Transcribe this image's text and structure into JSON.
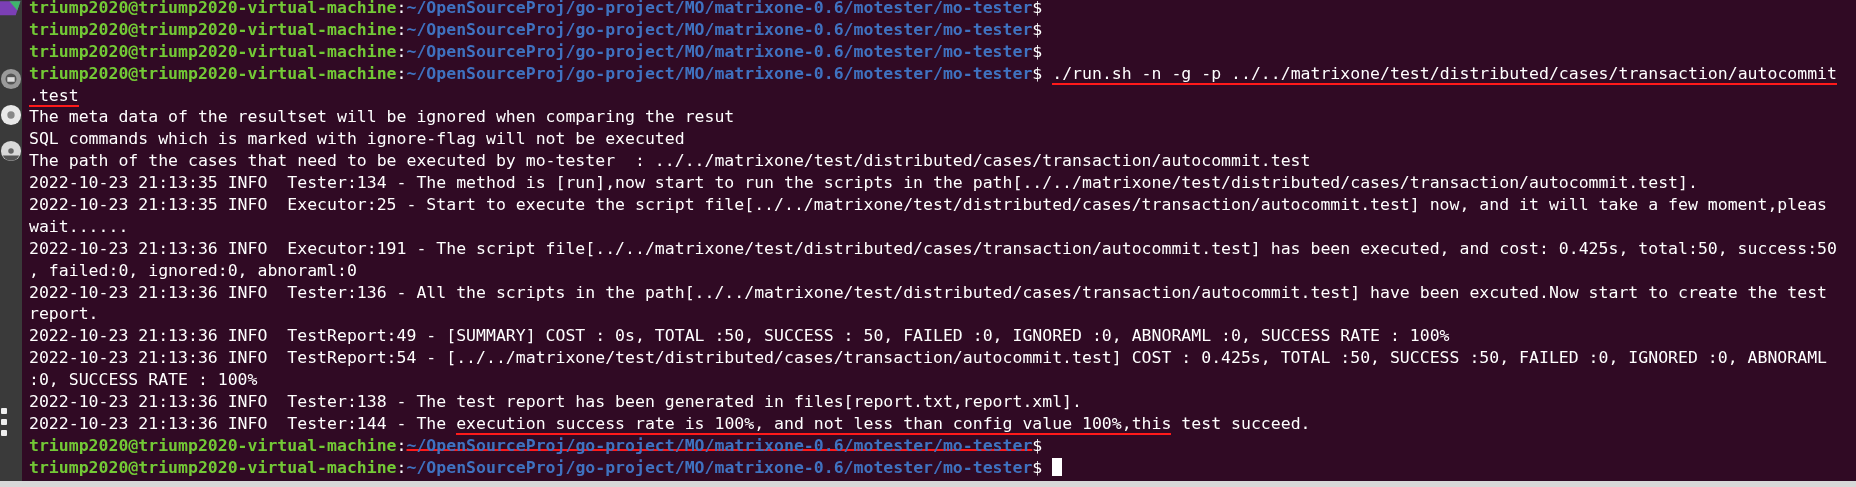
{
  "terminal": {
    "lines": [
      {
        "cursor": false,
        "segments": [
          {
            "text": "triump2020@triump2020-virtual-machine",
            "kind": "user"
          },
          {
            "text": ":",
            "kind": "text"
          },
          {
            "text": "~/OpenSourceProj/go-project/MO/matrixone-0.6/motester/mo-tester",
            "kind": "path"
          },
          {
            "text": "$",
            "kind": "text"
          }
        ]
      },
      {
        "cursor": false,
        "segments": [
          {
            "text": "triump2020@triump2020-virtual-machine",
            "kind": "user"
          },
          {
            "text": ":",
            "kind": "text"
          },
          {
            "text": "~/OpenSourceProj/go-project/MO/matrixone-0.6/motester/mo-tester",
            "kind": "path"
          },
          {
            "text": "$",
            "kind": "text"
          }
        ]
      },
      {
        "cursor": false,
        "segments": [
          {
            "text": "triump2020@triump2020-virtual-machine",
            "kind": "user"
          },
          {
            "text": ":",
            "kind": "text"
          },
          {
            "text": "~/OpenSourceProj/go-project/MO/matrixone-0.6/motester/mo-tester",
            "kind": "path"
          },
          {
            "text": "$",
            "kind": "text"
          }
        ]
      },
      {
        "cursor": false,
        "segments": [
          {
            "text": "triump2020@triump2020-virtual-machine",
            "kind": "user"
          },
          {
            "text": ":",
            "kind": "text"
          },
          {
            "text": "~/OpenSourceProj/go-project/MO/matrixone-0.6/motester/mo-tester",
            "kind": "path"
          },
          {
            "text": "$",
            "kind": "text"
          },
          {
            "text": "./run.sh -n -g -p ../../matrixone/test/distributed/cases/transaction/autocommit",
            "kind": "underlined"
          }
        ]
      },
      {
        "cursor": false,
        "segments": [
          {
            "text": ".test",
            "kind": "underlined"
          }
        ]
      },
      {
        "cursor": false,
        "segments": [
          {
            "text": "The meta data of the resultset will be ignored when comparing the resut",
            "kind": "text"
          }
        ]
      },
      {
        "cursor": false,
        "segments": [
          {
            "text": "SQL commands which is marked with ignore-flag will not be executed",
            "kind": "text"
          }
        ]
      },
      {
        "cursor": false,
        "segments": [
          {
            "text": "The path of the cases that need to be executed by mo-tester  : ../../matrixone/test/distributed/cases/transaction/autocommit.test",
            "kind": "text"
          }
        ]
      },
      {
        "cursor": false,
        "segments": [
          {
            "text": "2022-10-23 21:13:35 INFO  Tester:134 - The method is [run],now start to run the scripts in the path[../../matrixone/test/distributed/cases/transaction/autocommit.test].",
            "kind": "text"
          }
        ]
      },
      {
        "cursor": false,
        "segments": [
          {
            "text": "2022-10-23 21:13:35 INFO  Executor:25 - Start to execute the script file[../../matrixone/test/distributed/cases/transaction/autocommit.test] now, and it will take a few moment,pleas",
            "kind": "text"
          }
        ]
      },
      {
        "cursor": false,
        "segments": [
          {
            "text": "wait......",
            "kind": "text"
          }
        ]
      },
      {
        "cursor": false,
        "segments": [
          {
            "text": "2022-10-23 21:13:36 INFO  Executor:191 - The script file[../../matrixone/test/distributed/cases/transaction/autocommit.test] has been executed, and cost: 0.425s, total:50, success:50",
            "kind": "text"
          }
        ]
      },
      {
        "cursor": false,
        "segments": [
          {
            "text": ", failed:0, ignored:0, abnoraml:0",
            "kind": "text"
          }
        ]
      },
      {
        "cursor": false,
        "segments": [
          {
            "text": "2022-10-23 21:13:36 INFO  Tester:136 - All the scripts in the path[../../matrixone/test/distributed/cases/transaction/autocommit.test] have been excuted.Now start to create the test",
            "kind": "text"
          }
        ]
      },
      {
        "cursor": false,
        "segments": [
          {
            "text": "report.",
            "kind": "text"
          }
        ]
      },
      {
        "cursor": false,
        "segments": [
          {
            "text": "2022-10-23 21:13:36 INFO  TestReport:49 - [SUMMARY] COST : 0s, TOTAL :50, SUCCESS : 50, FAILED :0, IGNORED :0, ABNORAML :0, SUCCESS RATE : 100%",
            "kind": "text"
          }
        ]
      },
      {
        "cursor": false,
        "segments": [
          {
            "text": "2022-10-23 21:13:36 INFO  TestReport:54 - [../../matrixone/test/distributed/cases/transaction/autocommit.test] COST : 0.425s, TOTAL :50, SUCCESS :50, FAILED :0, IGNORED :0, ABNORAML",
            "kind": "text"
          }
        ]
      },
      {
        "cursor": false,
        "segments": [
          {
            "text": ":0, SUCCESS RATE : 100%",
            "kind": "text"
          }
        ]
      },
      {
        "cursor": false,
        "segments": [
          {
            "text": "2022-10-23 21:13:36 INFO  Tester:138 - The test report has been generated in files[report.txt,report.xml].",
            "kind": "text"
          }
        ]
      },
      {
        "cursor": false,
        "segments": [
          {
            "text": "2022-10-23 21:13:36 INFO  Tester:144 - The",
            "kind": "text"
          },
          {
            "text": "execution success rate is 100%, and not less than config value 100%,this",
            "kind": "underlined"
          },
          {
            "text": "test succeed.",
            "kind": "text"
          }
        ]
      },
      {
        "cursor": false,
        "segments": [
          {
            "text": "triump2020@triump2020-virtual-machine",
            "kind": "user"
          },
          {
            "text": ":",
            "kind": "text"
          },
          {
            "text": "~/OpenSourceProj/go-project/MO/matrixone-0.6/motester/mo-tester",
            "kind": "struck-path"
          },
          {
            "text": "$",
            "kind": "text"
          }
        ]
      },
      {
        "cursor": true,
        "segments": [
          {
            "text": "triump2020@triump2020-virtual-machine",
            "kind": "user"
          },
          {
            "text": ":",
            "kind": "text"
          },
          {
            "text": "~/OpenSourceProj/go-project/MO/matrixone-0.6/motester/mo-tester",
            "kind": "path"
          },
          {
            "text": "$",
            "kind": "text"
          }
        ]
      }
    ]
  }
}
